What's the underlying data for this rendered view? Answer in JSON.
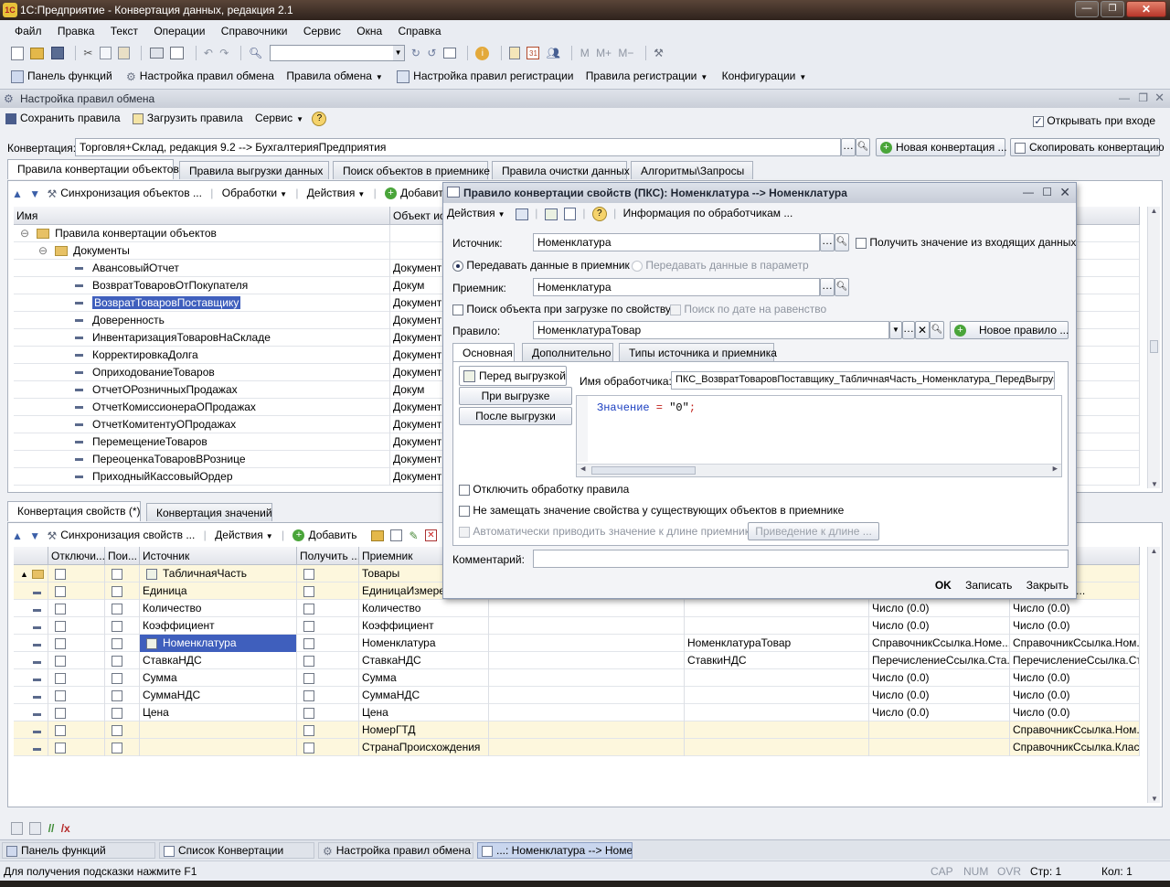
{
  "window": {
    "title": "1С:Предприятие - Конвертация данных, редакция 2.1"
  },
  "menubar": [
    "Файл",
    "Правка",
    "Текст",
    "Операции",
    "Справочники",
    "Сервис",
    "Окна",
    "Справка"
  ],
  "toolbar2": [
    "Панель функций",
    "Настройка правил обмена",
    "Правила обмена",
    "Настройка правил регистрации",
    "Правила регистрации",
    "Конфигурации"
  ],
  "subwin": {
    "title": "Настройка правил обмена"
  },
  "subtb": {
    "save": "Сохранить правила",
    "load": "Загрузить правила",
    "service": "Сервис",
    "open_on_enter": "Открывать при входе"
  },
  "conv": {
    "label": "Конвертация:",
    "value": "Торговля+Склад, редакция 9.2 --> БухгалтерияПредприятия",
    "new": "Новая конвертация ...",
    "copy": "Скопировать конвертацию"
  },
  "tabs": [
    "Правила конвертации объектов",
    "Правила выгрузки данных",
    "Поиск объектов в приемнике",
    "Правила очистки данных",
    "Алгоритмы\\Запросы"
  ],
  "tree_tb": {
    "sync": "Синхронизация объектов ...",
    "proc": "Обработки",
    "actions": "Действия",
    "add": "Добавить"
  },
  "tree": {
    "headers": [
      "Имя",
      "Объект ис"
    ],
    "root": "Правила конвертации объектов",
    "folder": "Документы",
    "items": [
      {
        "name": "АвансовыйОтчет",
        "obj": "Документ"
      },
      {
        "name": "ВозвратТоваровОтПокупателя",
        "obj": "Докум"
      },
      {
        "name": "ВозвратТоваровПоставщику",
        "obj": "Документ"
      },
      {
        "name": "Доверенность",
        "obj": "Документ"
      },
      {
        "name": "ИнвентаризацияТоваровНаСкладе",
        "obj": "Документ"
      },
      {
        "name": "КорректировкаДолга",
        "obj": "Документ"
      },
      {
        "name": "ОприходованиеТоваров",
        "obj": "Документ"
      },
      {
        "name": "ОтчетОРозничныхПродажах",
        "obj": "Докум"
      },
      {
        "name": "ОтчетКомиссионераОПродажах",
        "obj": "Документ"
      },
      {
        "name": "ОтчетКомитентуОПродажах",
        "obj": "Документ"
      },
      {
        "name": "ПеремещениеТоваров",
        "obj": "Документ"
      },
      {
        "name": "ПереоценкаТоваровВРознице",
        "obj": "Документ"
      },
      {
        "name": "ПриходныйКассовыйОрдер",
        "obj": "Документ"
      }
    ]
  },
  "btabs": [
    "Конвертация свойств (*)",
    "Конвертация значений"
  ],
  "btb": {
    "sync": "Синхронизация свойств ...",
    "actions": "Действия",
    "add": "Добавить"
  },
  "bgrid": {
    "headers": [
      "Отключи...",
      "Пои...",
      "Источник",
      "Получить ...",
      "Приемник",
      "",
      "",
      "",
      "а"
    ],
    "rows": [
      {
        "src": "ТабличнаяЧасть",
        "dst": "Товары",
        "c6": "",
        "c7": "",
        "c8": "",
        "c9": "ать"
      },
      {
        "src": "Единица",
        "dst": "ЕдиницаИзмерения",
        "c6": "",
        "c7": "",
        "c8": "",
        "c9": "СсылкаКлас..."
      },
      {
        "src": "Количество",
        "dst": "Количество",
        "c6": "",
        "c7": "",
        "c8": "Число (0.0)",
        "c9": "Число (0.0)"
      },
      {
        "src": "Коэффициент",
        "dst": "Коэффициент",
        "c6": "",
        "c7": "",
        "c8": "Число (0.0)",
        "c9": "Число (0.0)"
      },
      {
        "src": "Номенклатура",
        "dst": "Номенклатура",
        "c6": "",
        "c7": "НоменклатураТовар",
        "c8": "СправочникСсылка.Номе...",
        "c9": "СправочникСсылка.Ном..."
      },
      {
        "src": "СтавкаНДС",
        "dst": "СтавкаНДС",
        "c6": "",
        "c7": "СтавкиНДС",
        "c8": "ПеречислениеСсылка.Ста...",
        "c9": "ПеречислениеСсылка.Ст..."
      },
      {
        "src": "Сумма",
        "dst": "Сумма",
        "c6": "",
        "c7": "",
        "c8": "Число (0.0)",
        "c9": "Число (0.0)"
      },
      {
        "src": "СуммаНДС",
        "dst": "СуммаНДС",
        "c6": "",
        "c7": "",
        "c8": "Число (0.0)",
        "c9": "Число (0.0)"
      },
      {
        "src": "Цена",
        "dst": "Цена",
        "c6": "",
        "c7": "",
        "c8": "Число (0.0)",
        "c9": "Число (0.0)"
      },
      {
        "src": "",
        "dst": "НомерГТД",
        "c6": "",
        "c7": "",
        "c8": "",
        "c9": "СправочникСсылка.Ном..."
      },
      {
        "src": "",
        "dst": "СтранаПроисхождения",
        "c6": "",
        "c7": "",
        "c8": "",
        "c9": "СправочникСсылка.Клас..."
      }
    ]
  },
  "dialog": {
    "title": "Правило конвертации свойств (ПКС): Номенклатура --> Номенклатура",
    "actions": "Действия",
    "handlers_info": "Информация по обработчикам ...",
    "src_label": "Источник:",
    "src_value": "Номенклатура",
    "get_incoming": "Получить значение из входящих данных",
    "pass_to_dst": "Передавать данные в приемник",
    "pass_to_param": "Передавать данные в параметр",
    "dst_label": "Приемник:",
    "dst_value": "Номенклатура",
    "search_by_prop": "Поиск объекта при загрузке по свойству",
    "search_by_date": "Поиск по дате на равенство",
    "rule_label": "Правило:",
    "rule_value": "НоменклатураТовар",
    "new_rule": "Новое правило ...",
    "tabs": [
      "Основная",
      "Дополнительно",
      "Типы источника и приемника"
    ],
    "events": [
      "Перед выгрузкой",
      "При выгрузке",
      "После выгрузки"
    ],
    "handler_label": "Имя обработчика:",
    "handler_value": "ПКС_ВозвратТоваровПоставщику_ТабличнаяЧасть_Номенклатура_ПередВыгрузкой",
    "code_kw": "Значение",
    "code_eq": " = ",
    "code_str": "\"0\"",
    "code_semi": ";",
    "disable_proc": "Отключить обработку правила",
    "no_replace": "Не замещать значение свойства у существующих объектов в приемнике",
    "auto_len": "Автоматически приводить значение к длине приемника",
    "to_len": "Приведение к длине ...",
    "comment_label": "Комментарий:",
    "ok": "OK",
    "write": "Записать",
    "close": "Закрыть"
  },
  "taskbar": [
    "Панель функций",
    "Список Конвертации",
    "Настройка правил обмена",
    "...: Номенклатура --> Номен..."
  ],
  "status": {
    "hint": "Для получения подсказки нажмите F1",
    "cap": "CAP",
    "num": "NUM",
    "ovr": "OVR",
    "line": "Стр: 1",
    "col": "Кол: 1"
  },
  "colors": {
    "title_bg": "#3b2a22",
    "select": "#3f5fbd",
    "row_yellow": "#fdf7dd",
    "dialog_border": "#9fb0c9"
  }
}
